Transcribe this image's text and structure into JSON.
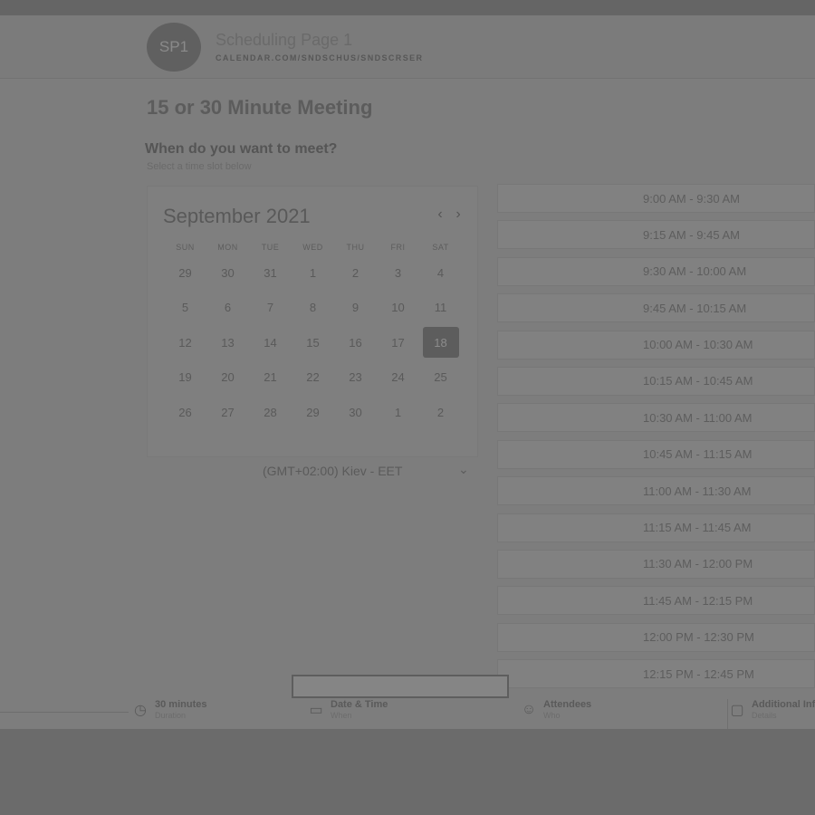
{
  "header": {
    "avatar_initials": "SP1",
    "page_name": "Scheduling Page 1",
    "page_url": "CALENDAR.COM/SNDSCHUS/SNDSCRSER"
  },
  "meeting": {
    "title": "15 or 30 Minute Meeting",
    "question": "When do you want to meet?",
    "hint": "Select a time slot below"
  },
  "calendar": {
    "month": "September 2021",
    "prev_icon": "‹",
    "next_icon": "›",
    "weekdays": [
      "SUN",
      "MON",
      "TUE",
      "WED",
      "THU",
      "FRI",
      "SAT"
    ],
    "days": [
      "29",
      "30",
      "31",
      "1",
      "2",
      "3",
      "4",
      "5",
      "6",
      "7",
      "8",
      "9",
      "10",
      "11",
      "12",
      "13",
      "14",
      "15",
      "16",
      "17",
      "18",
      "19",
      "20",
      "21",
      "22",
      "23",
      "24",
      "25",
      "26",
      "27",
      "28",
      "29",
      "30",
      "1",
      "2"
    ],
    "selected_day": "18"
  },
  "timezone": {
    "label": "(GMT+02:00) Kiev - EET",
    "chevron": "⌄"
  },
  "slots": [
    "9:00 AM - 9:30 AM",
    "9:15 AM - 9:45 AM",
    "9:30 AM - 10:00 AM",
    "9:45 AM - 10:15 AM",
    "10:00 AM - 10:30 AM",
    "10:15 AM - 10:45 AM",
    "10:30 AM - 11:00 AM",
    "10:45 AM - 11:15 AM",
    "11:00 AM - 11:30 AM",
    "11:15 AM - 11:45 AM",
    "11:30 AM - 12:00 PM",
    "11:45 AM - 12:15 PM",
    "12:00 PM - 12:30 PM",
    "12:15 PM - 12:45 PM"
  ],
  "footer": {
    "steps": [
      {
        "icon": "clock-icon",
        "glyph": "◷",
        "title": "30 minutes",
        "sub": "Duration"
      },
      {
        "icon": "calendar-icon",
        "glyph": "▭",
        "title": "Date & Time",
        "sub": "When"
      },
      {
        "icon": "users-icon",
        "glyph": "☺",
        "title": "Attendees",
        "sub": "Who"
      },
      {
        "icon": "info-icon",
        "glyph": "▢",
        "title": "Additional Info",
        "sub": "Details"
      }
    ]
  }
}
